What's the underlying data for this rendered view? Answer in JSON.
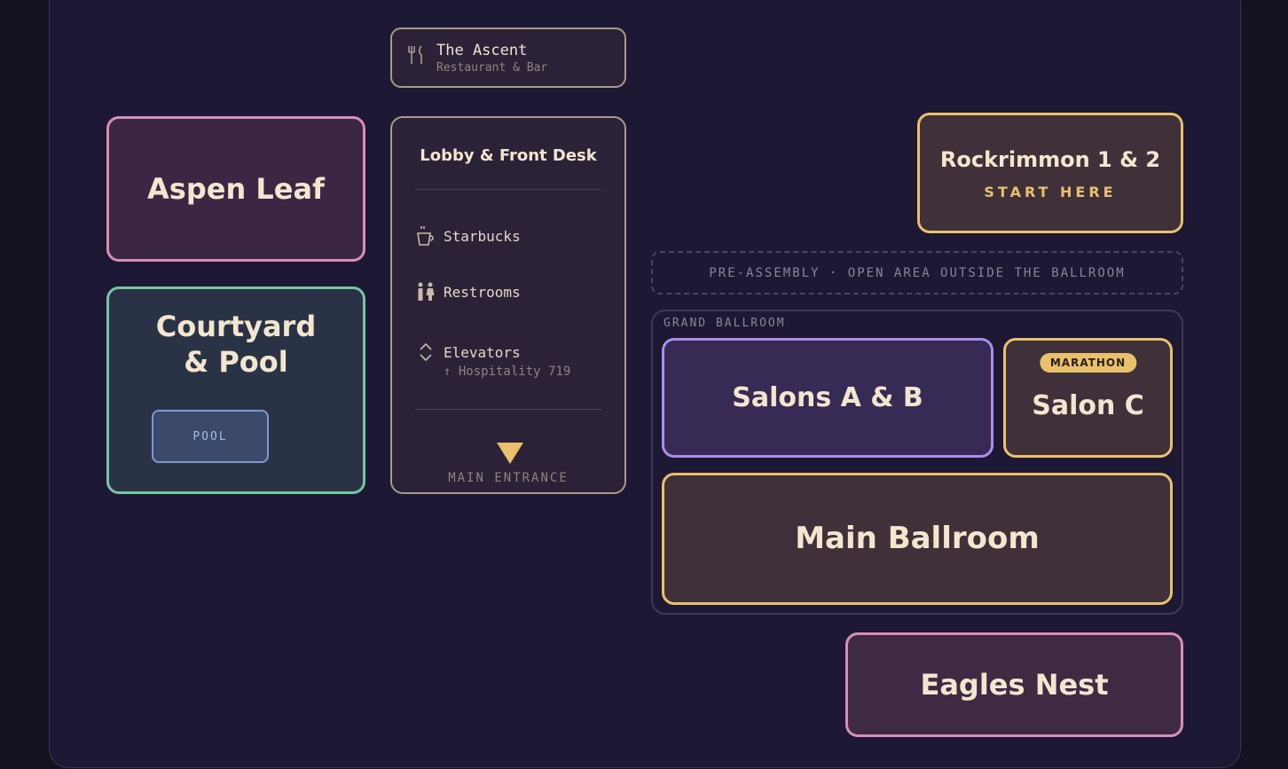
{
  "ascent": {
    "name": "The Ascent",
    "subtitle": "Restaurant & Bar",
    "icon": "fork-knife-icon"
  },
  "rooms": {
    "aspen_leaf": "Aspen Leaf",
    "courtyard_line1": "Courtyard",
    "courtyard_line2": "& Pool",
    "pool_label": "POOL",
    "rockrimmon": "Rockrimmon 1 & 2",
    "rockrimmon_tag": "START HERE",
    "salons_ab": "Salons A & B",
    "salon_c": "Salon C",
    "salon_c_badge": "MARATHON",
    "main_ballroom": "Main Ballroom",
    "eagles_nest": "Eagles Nest"
  },
  "lobby": {
    "title": "Lobby & Front Desk",
    "amenities": [
      {
        "label": "Starbucks",
        "icon": "coffee-icon"
      },
      {
        "label": "Restrooms",
        "icon": "restroom-icon"
      },
      {
        "label": "Elevators",
        "icon": "elevator-icon",
        "note": "↑ Hospitality 719"
      }
    ],
    "entrance": "MAIN ENTRANCE"
  },
  "pre_assembly": "PRE-ASSEMBLY · OPEN AREA OUTSIDE THE BALLROOM",
  "grand_ballroom_label": "GRAND BALLROOM",
  "colors": {
    "background": "#1d1833",
    "gold": "#e9c16b",
    "pink": "#d88fb7",
    "green": "#78c4a2",
    "purple": "#ac8cf0",
    "blue": "#7b9ad0"
  }
}
